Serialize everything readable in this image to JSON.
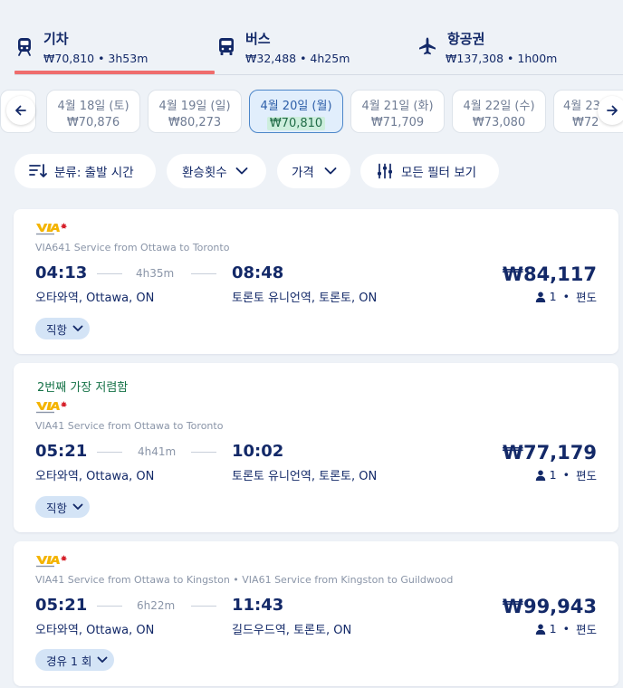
{
  "mode_tabs": [
    {
      "title": "기차",
      "sub": "₩70,810 • 3h53m",
      "icon": "train-icon",
      "active": true
    },
    {
      "title": "버스",
      "sub": "₩32,488 • 4h25m",
      "icon": "bus-icon",
      "active": false
    },
    {
      "title": "항공권",
      "sub": "₩137,308 • 1h00m",
      "icon": "plane-icon",
      "active": false
    }
  ],
  "dates": [
    {
      "date": "4월 18일 (토)",
      "price": "₩70,876"
    },
    {
      "date": "4월 19일 (일)",
      "price": "₩80,273"
    },
    {
      "date": "4월 20일 (월)",
      "price": "₩70,810"
    },
    {
      "date": "4월 21일 (화)",
      "price": "₩71,709"
    },
    {
      "date": "4월 22일 (수)",
      "price": "₩73,080"
    },
    {
      "date": "4월 23",
      "price": "₩72"
    }
  ],
  "filters": {
    "sort": "분류: 출발 시간",
    "transfers": "환승횟수",
    "price": "가격",
    "all_filters": "모든 필터 보기"
  },
  "results": [
    {
      "tag": "",
      "service": "VIA641 Service from Ottawa to Toronto",
      "dep_time": "04:13",
      "duration": "4h35m",
      "arr_time": "08:48",
      "dep_station": "오타와역, Ottawa, ON",
      "arr_station": "토론토 유니언역, 토론토, ON",
      "price": "₩84,117",
      "passengers": "1",
      "trip": "편도",
      "stops": "직항"
    },
    {
      "tag": "2번째 가장 저렴함",
      "service": "VIA41 Service from Ottawa to Toronto",
      "dep_time": "05:21",
      "duration": "4h41m",
      "arr_time": "10:02",
      "dep_station": "오타와역, Ottawa, ON",
      "arr_station": "토론토 유니언역, 토론토, ON",
      "price": "₩77,179",
      "passengers": "1",
      "trip": "편도",
      "stops": "직항"
    },
    {
      "tag": "",
      "service": "VIA41 Service from Ottawa to Kingston • VIA61 Service from Kingston to Guildwood",
      "dep_time": "05:21",
      "duration": "6h22m",
      "arr_time": "11:43",
      "dep_station": "오타와역, Ottawa, ON",
      "arr_station": "길드우드역, 토론토, ON",
      "price": "₩99,943",
      "passengers": "1",
      "trip": "편도",
      "stops": "경유 1 회"
    }
  ],
  "colors": {
    "navy": "#132968",
    "active_tab_bar": "#ef6d6d",
    "active_date_bg": "#e1eefc",
    "cheapest_tag": "#177348",
    "via_yellow": "#f4b400",
    "via_red": "#d6202a"
  }
}
